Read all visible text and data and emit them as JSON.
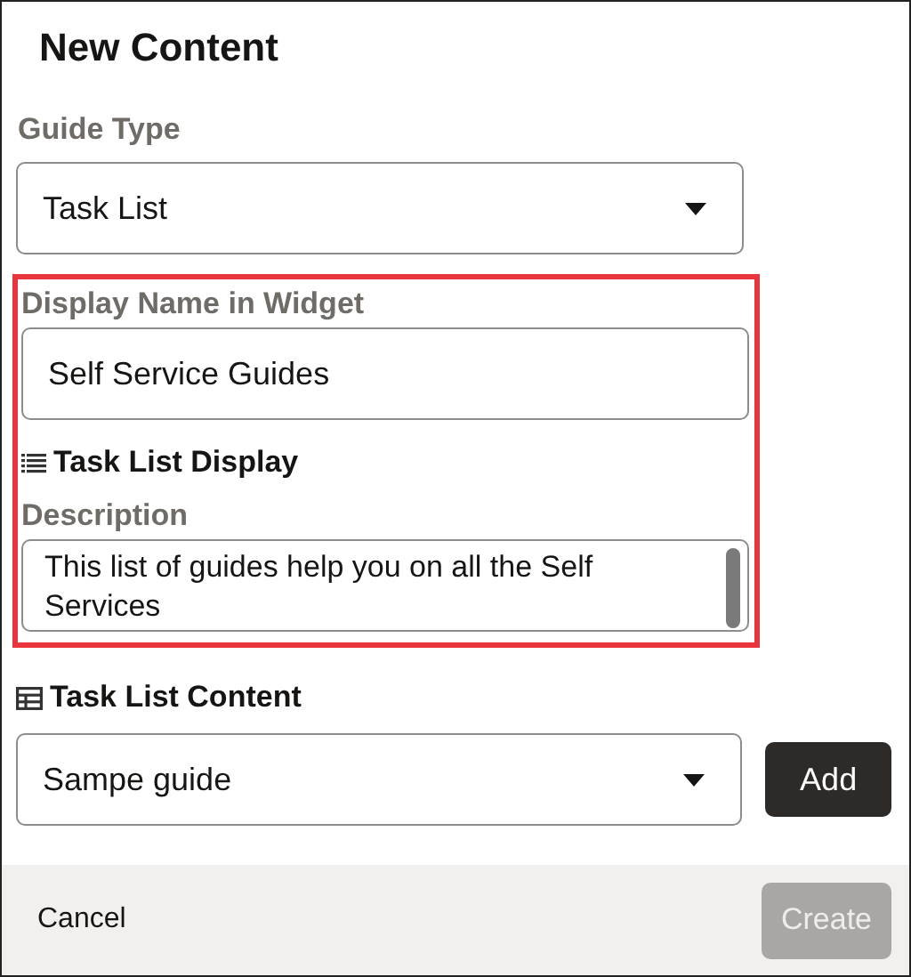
{
  "title": "New Content",
  "guide_type": {
    "label": "Guide Type",
    "value": "Task List"
  },
  "highlighted_section": {
    "highlighted": true,
    "display_name": {
      "label": "Display Name in Widget",
      "value": "Self Service Guides"
    },
    "task_list_display": {
      "heading": "Task List Display"
    },
    "description": {
      "label": "Description",
      "value": "This list of guides help you on all the Self Services"
    }
  },
  "task_list_content": {
    "heading": "Task List Content",
    "value": "Sampe guide",
    "add_button": "Add"
  },
  "footer": {
    "cancel": "Cancel",
    "create": {
      "label": "Create",
      "disabled": true
    }
  }
}
